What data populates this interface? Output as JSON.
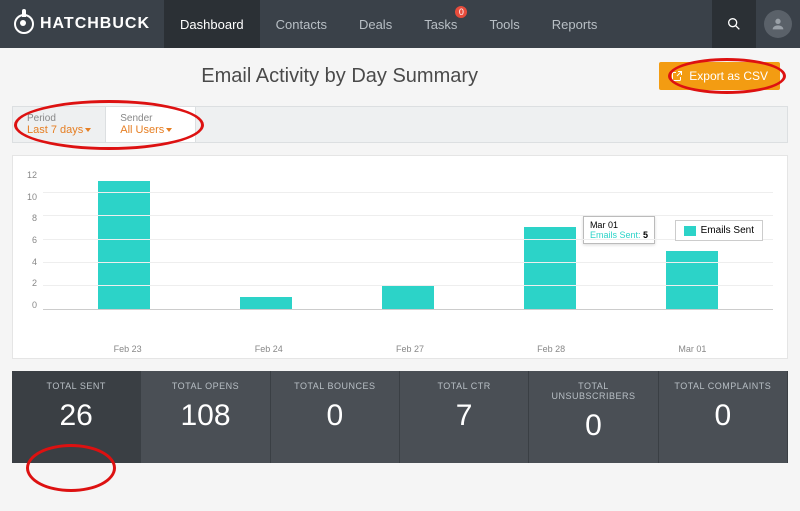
{
  "brand": "HATCHBUCK",
  "nav": {
    "items": [
      {
        "label": "Dashboard",
        "active": true,
        "badge": null
      },
      {
        "label": "Contacts",
        "active": false,
        "badge": null
      },
      {
        "label": "Deals",
        "active": false,
        "badge": null
      },
      {
        "label": "Tasks",
        "active": false,
        "badge": "0"
      },
      {
        "label": "Tools",
        "active": false,
        "badge": null
      },
      {
        "label": "Reports",
        "active": false,
        "badge": null
      }
    ]
  },
  "page": {
    "title": "Email Activity by Day Summary",
    "export_label": "Export as CSV"
  },
  "filters": {
    "period": {
      "label": "Period",
      "value": "Last 7 days"
    },
    "sender": {
      "label": "Sender",
      "value": "All Users"
    }
  },
  "chart_data": {
    "type": "bar",
    "categories": [
      "Feb 23",
      "Feb 24",
      "Feb 27",
      "Feb 28",
      "Mar 01"
    ],
    "values": [
      11,
      1,
      2,
      7,
      5
    ],
    "title": "",
    "xlabel": "",
    "ylabel": "",
    "ylim": [
      0,
      12
    ],
    "legend": "Emails Sent",
    "tooltip": {
      "x": "Mar 01",
      "series": "Emails Sent:",
      "value": "5"
    }
  },
  "stats": [
    {
      "label": "TOTAL SENT",
      "value": "26"
    },
    {
      "label": "TOTAL OPENS",
      "value": "108"
    },
    {
      "label": "TOTAL BOUNCES",
      "value": "0"
    },
    {
      "label": "TOTAL CTR",
      "value": "7"
    },
    {
      "label": "TOTAL UNSUBSCRIBERS",
      "value": "0"
    },
    {
      "label": "TOTAL COMPLAINTS",
      "value": "0"
    }
  ]
}
